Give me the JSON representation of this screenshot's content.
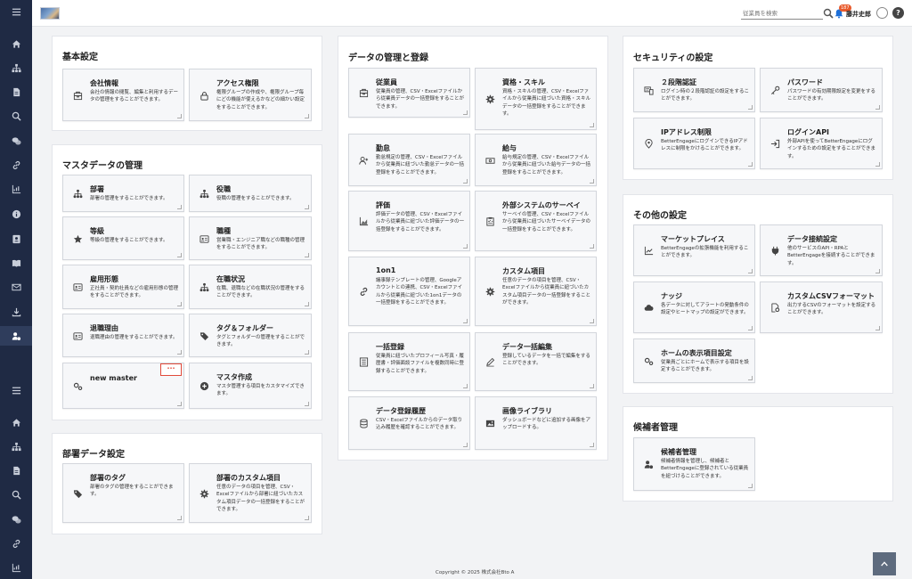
{
  "header": {
    "search_placeholder": "従業員を検索",
    "notification_count": "187",
    "username": "藤井史郎",
    "help_label": "?"
  },
  "sidebar": {
    "items": [
      "menu-icon",
      "home-icon",
      "org-chart-icon",
      "document-icon",
      "search-icon",
      "chat-icon",
      "link-icon",
      "chart-icon",
      "info-icon",
      "id-card-icon",
      "book-icon",
      "mail-icon",
      "download-icon",
      "user-settings-icon",
      "menu-icon",
      "home-icon",
      "org-chart-icon",
      "document-icon",
      "search-icon",
      "chat-icon",
      "link-icon",
      "chart-icon"
    ]
  },
  "sections": {
    "basic": {
      "title": "基本設定",
      "cards": [
        {
          "title": "会社情報",
          "desc": "会社の情報の閲覧、編集と利用するデータの管理をすることができます。"
        },
        {
          "title": "アクセス権限",
          "desc": "権限グループの作成や、権限グループ毎にどの機能が使えるかなどの細かい設定をすることができます。"
        }
      ]
    },
    "master": {
      "title": "マスタデータの管理",
      "cards": [
        {
          "title": "部署",
          "desc": "部署の管理をすることができます。"
        },
        {
          "title": "役職",
          "desc": "役職の管理をすることができます。"
        },
        {
          "title": "等級",
          "desc": "等級の管理をすることができます。"
        },
        {
          "title": "職種",
          "desc": "営業職・エンジニア職などの職種の管理をすることができます。"
        },
        {
          "title": "雇用形態",
          "desc": "正社員・契約社員などの雇用形態の管理をすることができます。"
        },
        {
          "title": "在職状況",
          "desc": "在職、退職などの在職状況の管理をすることができます。"
        },
        {
          "title": "退職理由",
          "desc": "退職理由の管理をすることができます。"
        },
        {
          "title": "タグ＆フォルダー",
          "desc": "タグとフォルダーの管理をすることができます。"
        },
        {
          "title": "new master",
          "desc": ""
        },
        {
          "title": "マスタ作成",
          "desc": "マスタ管理する項目をカスタマイズできます。"
        }
      ],
      "more_label": "···"
    },
    "dept": {
      "title": "部署データ設定",
      "cards": [
        {
          "title": "部署のタグ",
          "desc": "部署のタグの管理をすることができます。"
        },
        {
          "title": "部署のカスタム項目",
          "desc": "任意のデータの項目を管理、CSV・Excelファイルから部署に紐づいたカスタム項目データの一括登録をすることができます。"
        }
      ]
    },
    "data": {
      "title": "データの管理と登録",
      "cards": [
        {
          "title": "従業員",
          "desc": "従業員の管理、CSV・Excelファイルから従業員データの一括登録をすることができます。"
        },
        {
          "title": "資格・スキル",
          "desc": "資格・スキルの管理、CSV・Excelファイルから従業員に紐づいた資格・スキルデータの一括登録をすることができます。"
        },
        {
          "title": "勤怠",
          "desc": "勤怠規定の管理、CSV・Excelファイルから従業員に紐づいた勤怠データの一括登録をすることができます。"
        },
        {
          "title": "給与",
          "desc": "給与規定の管理、CSV・Excelファイルから従業員に紐づいた給与データの一括登録をすることができます。"
        },
        {
          "title": "評価",
          "desc": "評価データの管理、CSV・Excelファイルから従業員に紐づいた評価データの一括登録をすることができます。"
        },
        {
          "title": "外部システムのサーベイ",
          "desc": "サーベイの管理、CSV・Excelファイルから従業員に紐づいたサーベイデータの一括登録をすることができます。"
        },
        {
          "title": "1on1",
          "desc": "議事録テンプレートの管理、Googleアカウントとの連携、CSV・Excelファイルから従業員に紐づいた1on1データの一括登録をすることができます。"
        },
        {
          "title": "カスタム項目",
          "desc": "任意のデータの項目を管理、CSV・Excelファイルから従業員に紐づいたカスタム項目データの一括登録をすることができます。"
        },
        {
          "title": "一括登録",
          "desc": "従業員に紐づいたプロフィール写真・履歴書・評価面談ファイルを複数同時に登録することができます。"
        },
        {
          "title": "データ一括編集",
          "desc": "登録しているデータを一括で編集をすることができます。"
        },
        {
          "title": "データ登録履歴",
          "desc": "CSV・Excelファイルからのデータ取り込み履歴を確認することができます。"
        },
        {
          "title": "画像ライブラリ",
          "desc": "ダッシュボードなどに追加する画像をアップロードする。"
        }
      ]
    },
    "security": {
      "title": "セキュリティの設定",
      "cards": [
        {
          "title": "２段階認証",
          "desc": "ログイン時の２段階認証の設定をすることができます。"
        },
        {
          "title": "パスワード",
          "desc": "パスワードの有効期限設定を変更をすることができます。"
        },
        {
          "title": "IPアドレス制限",
          "desc": "BetterEngageにログインできるIPアドレスに制限をかけることができます。"
        },
        {
          "title": "ログインAPI",
          "desc": "外部APIを使ってBetterEngageにログインするための設定をすることができます。"
        }
      ]
    },
    "other": {
      "title": "その他の設定",
      "cards": [
        {
          "title": "マーケットプレイス",
          "desc": "BetterEngageの拡張機能を利用することができます。"
        },
        {
          "title": "データ接続設定",
          "desc": "他のサービスのAPI・RPAとBetterEngageを接続することができます。"
        },
        {
          "title": "ナッジ",
          "desc": "各データに対してアラートの発動条件の設定やヒートマップの設定ができます。"
        },
        {
          "title": "カスタムCSVフォーマット",
          "desc": "出力するCSVのフォーマットを設定することができます。"
        },
        {
          "title": "ホームの表示項目設定",
          "desc": "従業員ごとにホームで表示する項目を設定することができます。"
        }
      ]
    },
    "candidate": {
      "title": "候補者管理",
      "cards": [
        {
          "title": "候補者管理",
          "desc": "候補者情報を管理し、候補者とBetterEngageに登録されている従業員を紐づけることができます。"
        }
      ]
    }
  },
  "footer": {
    "copyright": "Copyright © 2025 株式会社Bto A"
  }
}
